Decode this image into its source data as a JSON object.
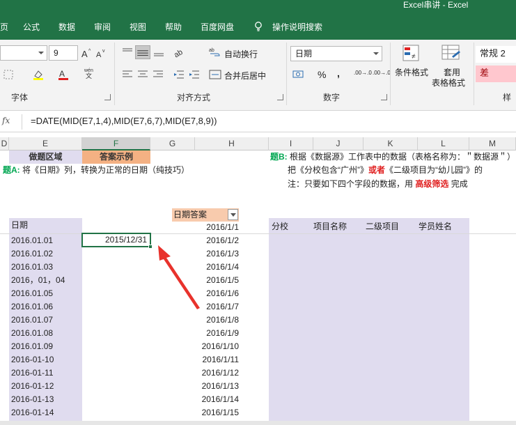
{
  "window": {
    "title": "Excel串讲  -  Excel"
  },
  "tabs": [
    "页",
    "公式",
    "数据",
    "审阅",
    "视图",
    "帮助",
    "百度网盘",
    "操作说明搜索"
  ],
  "ribbon": {
    "font_size": "9",
    "font_group": "字体",
    "align_group": "对齐方式",
    "wrap_text": "自动换行",
    "merge_center": "合并后居中",
    "number_format": "日期",
    "number_group": "数字",
    "percent": "%",
    "comma": ",",
    "cond_format": "条件格式",
    "table_format_1": "套用",
    "table_format_2": "表格格式",
    "style_normal": "常规 2",
    "style_bad": "差",
    "styles_group": "样",
    "increase_decimal": ".00→.0",
    "decrease_decimal": ".00→.0",
    "phonetic": "wén"
  },
  "formula_bar": {
    "fx": "fx",
    "formula": "=DATE(MID(E7,1,4),MID(E7,6,7),MID(E7,8,9))"
  },
  "columns": [
    "D",
    "E",
    "F",
    "G",
    "H",
    "I",
    "J",
    "K",
    "L",
    "M"
  ],
  "sheet": {
    "header_do": "做题区域",
    "header_answer": "答案示例",
    "taskA_prefix": "题A:",
    "taskA_text": "将《日期》列，转换为正常的日期（纯技巧）",
    "taskB_prefix": "题B:",
    "taskB_text": "根据《数据源》工作表中的数据（表格名称为：＂数据源＂）",
    "line2_a": "把《分校包含“广州”》",
    "line2_or": "或者",
    "line2_b": "《二级项目为“幼儿园”》的",
    "note_a": "注：只要如下四个字段的数据，用",
    "note_red": "高级筛选",
    "note_b": "完成",
    "date_header": "日期",
    "answer_header": "日期答案",
    "right_headers": [
      "分校",
      "项目名称",
      "二级项目",
      "学员姓名"
    ],
    "active_value": "2015/12/31",
    "dates": [
      "2016.01.01",
      "2016.01.02",
      "2016.01.03",
      "2016，01，04",
      "2016.01.05",
      "2016.01.06",
      "2016.01.07",
      "2016.01.08",
      "2016.01.09",
      "2016-01-10",
      "2016-01-11",
      "2016-01-12",
      "2016-01-13",
      "2016-01-14"
    ],
    "answers": [
      "2016/1/1",
      "2016/1/2",
      "2016/1/3",
      "2016/1/4",
      "2016/1/5",
      "2016/1/6",
      "2016/1/7",
      "2016/1/8",
      "2016/1/9",
      "2016/1/10",
      "2016/1/11",
      "2016/1/12",
      "2016/1/13",
      "2016/1/14",
      "2016/1/15"
    ]
  },
  "colors": {
    "excel_green": "#217346",
    "lavender": "#e0dcef",
    "answer_orange": "#f4b183",
    "arrow_red": "#e8322c"
  }
}
